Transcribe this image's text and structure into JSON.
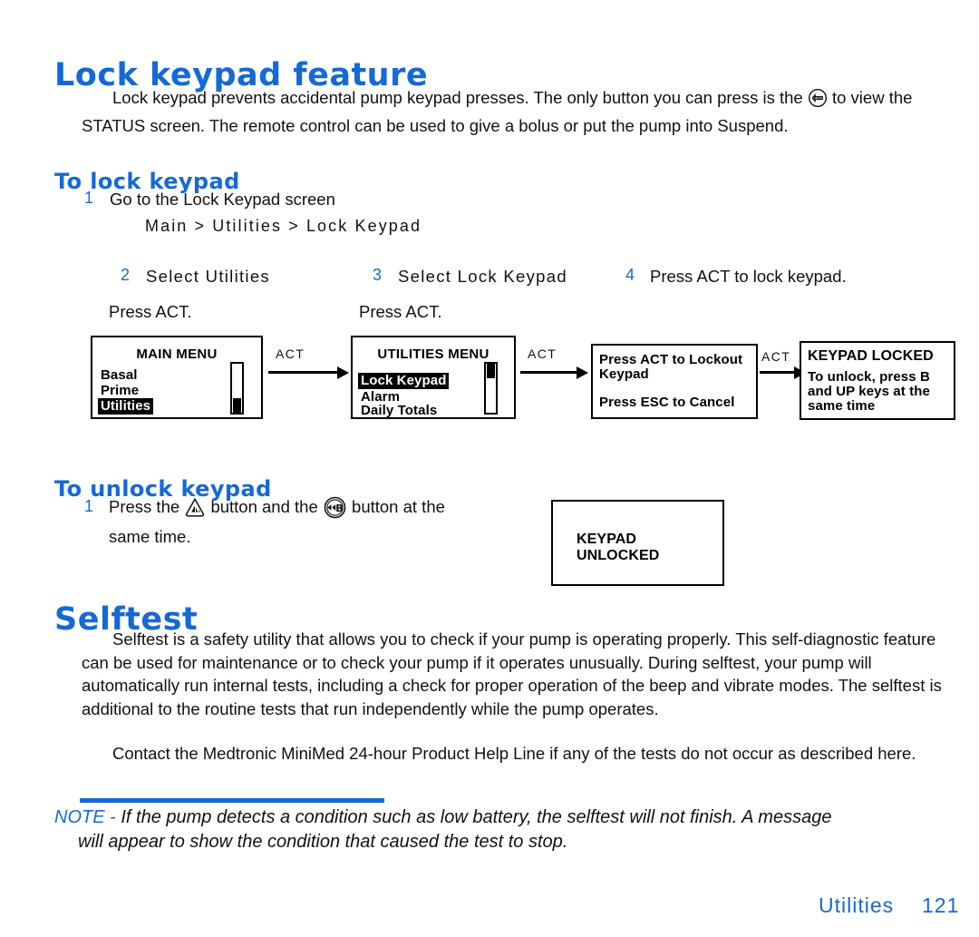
{
  "sections": {
    "lock_feature": {
      "title": "Lock keypad feature",
      "intro_part1": "Lock keypad prevents accidental pump keypad presses. The only button you can press is the",
      "intro_part2": "to view the STATUS screen. The remote control can be used to give a bolus or put the pump into Suspend."
    },
    "to_lock": {
      "title": "To lock keypad",
      "step1_num": "1",
      "step1_text": "Go to the Lock Keypad screen",
      "breadcrumb": "Main > Utilities > Lock Keypad",
      "step2_num": "2",
      "step2_text": "Select Utilities",
      "step2_sub": "Press ACT.",
      "step3_num": "3",
      "step3_text": "Select Lock Keypad",
      "step3_sub": "Press ACT.",
      "step4_num": "4",
      "step4_text": "Press ACT to lock keypad."
    },
    "to_unlock": {
      "title": "To unlock keypad",
      "step1_num": "1",
      "step1_part1": "Press the",
      "step1_part2": "button and the",
      "step1_part3": "button at the",
      "step1_part4": "same time."
    },
    "selftest": {
      "title": "Selftest",
      "para1": "Selftest is a safety utility that allows you to check if your pump is operating properly. This self-diagnostic feature can be used for maintenance or to check your pump if it operates unusually. During selftest, your pump will automatically run internal tests, including a check for proper operation of the beep and vibrate modes. The selftest is additional to the routine tests that run independently while the pump operates.",
      "para2": "Contact the Medtronic MiniMed 24-hour Product Help Line if any of the tests do not occur as described here."
    }
  },
  "flow": {
    "arrow1_label": "ACT",
    "arrow2_label": "ACT",
    "arrow3_label": "ACT",
    "screen_main": {
      "title": "MAIN MENU",
      "items": [
        "Basal",
        "Prime",
        "Utilities"
      ],
      "selected": "Utilities"
    },
    "screen_utilities": {
      "title": "UTILITIES MENU",
      "items": [
        "Lock Keypad",
        "Alarm",
        "Daily Totals"
      ],
      "selected": "Lock Keypad"
    },
    "screen_confirm": {
      "line1": "Press ACT to Lockout",
      "line2": "Keypad",
      "line3": "Press ESC to Cancel"
    },
    "screen_locked": {
      "title": "KEYPAD LOCKED",
      "line1": "To unlock, press B",
      "line2": "and UP keys at the",
      "line3": "same time"
    },
    "screen_unlocked": {
      "line1": "KEYPAD",
      "line2": "UNLOCKED"
    }
  },
  "note": {
    "label": "NOTE -",
    "line1": "If the pump detects a condition such as low battery, the selftest will not finish. A message",
    "line2": "will appear to show the condition that caused the test to stop."
  },
  "footer": {
    "chapter": "Utilities",
    "page_number": "121"
  },
  "icons": {
    "esc_button": "esc-button-icon",
    "up_button": "up-arrow-button-icon",
    "bolus_button": "bolus-b-button-icon"
  },
  "colors": {
    "accent_blue": "#1569d6",
    "text_black": "#111111"
  }
}
